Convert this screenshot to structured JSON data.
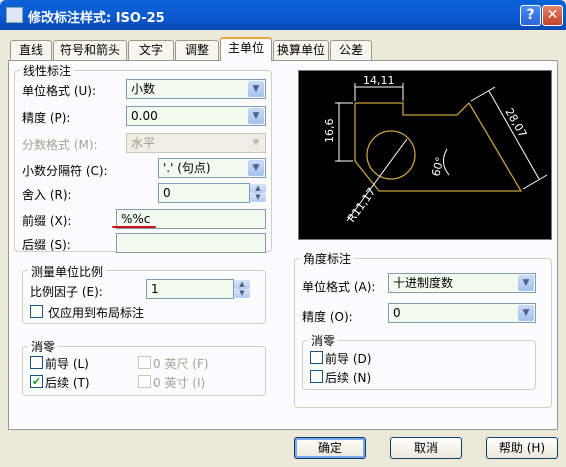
{
  "window": {
    "title": "修改标注样式: ISO-25",
    "help_label": "?",
    "close_label": "✕"
  },
  "tabs": [
    "直线",
    "符号和箭头",
    "文字",
    "调整",
    "主单位",
    "换算单位",
    "公差"
  ],
  "linear": {
    "group_label": "线性标注",
    "unit_format_label": "单位格式 (U):",
    "unit_format_value": "小数",
    "precision_label": "精度 (P):",
    "precision_value": "0.00",
    "fraction_label": "分数格式 (M):",
    "fraction_value": "水平",
    "decimal_sep_label": "小数分隔符 (C):",
    "decimal_sep_value": "'.' (句点)",
    "round_label": "舍入 (R):",
    "round_value": "0",
    "prefix_label": "前缀 (X):",
    "prefix_value": "%%c",
    "suffix_label": "后缀 (S):",
    "suffix_value": ""
  },
  "scale": {
    "group_label": "测量单位比例",
    "factor_label": "比例因子 (E):",
    "factor_value": "1",
    "layout_only_label": "仅应用到布局标注"
  },
  "zero_linear": {
    "group_label": "消零",
    "leading_label": "前导 (L)",
    "trailing_label": "后续 (T)",
    "feet_label": "0 英尺 (F)",
    "inches_label": "0 英寸 (I)",
    "leading_checked": false,
    "trailing_checked": true
  },
  "preview": {
    "dim_top": "14,11",
    "dim_left": "16,6",
    "dim_right": "28,07",
    "dim_angle": "60°",
    "dim_radius": "R11,17"
  },
  "angular": {
    "group_label": "角度标注",
    "unit_format_label": "单位格式 (A):",
    "unit_format_value": "十进制度数",
    "precision_label": "精度 (O):",
    "precision_value": "0"
  },
  "zero_angular": {
    "group_label": "消零",
    "leading_label": "前导 (D)",
    "trailing_label": "后续 (N)"
  },
  "buttons": {
    "ok": "确定",
    "cancel": "取消",
    "help": "帮助 (H)"
  },
  "colors": {
    "title_bar": "#0b5ad1",
    "panel_bg": "#fcfcfe",
    "field_bg": "#f3fbef",
    "annotation_red": "#d01020",
    "preview_line": "#c8a040"
  }
}
